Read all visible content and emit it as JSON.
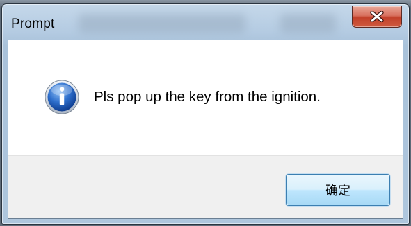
{
  "window": {
    "title": "Prompt",
    "close_icon": "close-icon"
  },
  "dialog": {
    "icon": "information-icon",
    "message": "Pls pop up the key from the ignition.",
    "ok_label": "确定"
  },
  "colors": {
    "frame": "#aec6dd",
    "close_button": "#c2402a",
    "info_icon": "#1e5fb8",
    "footer": "#f0f0f0",
    "ok_button_border": "#3c7fb1"
  }
}
